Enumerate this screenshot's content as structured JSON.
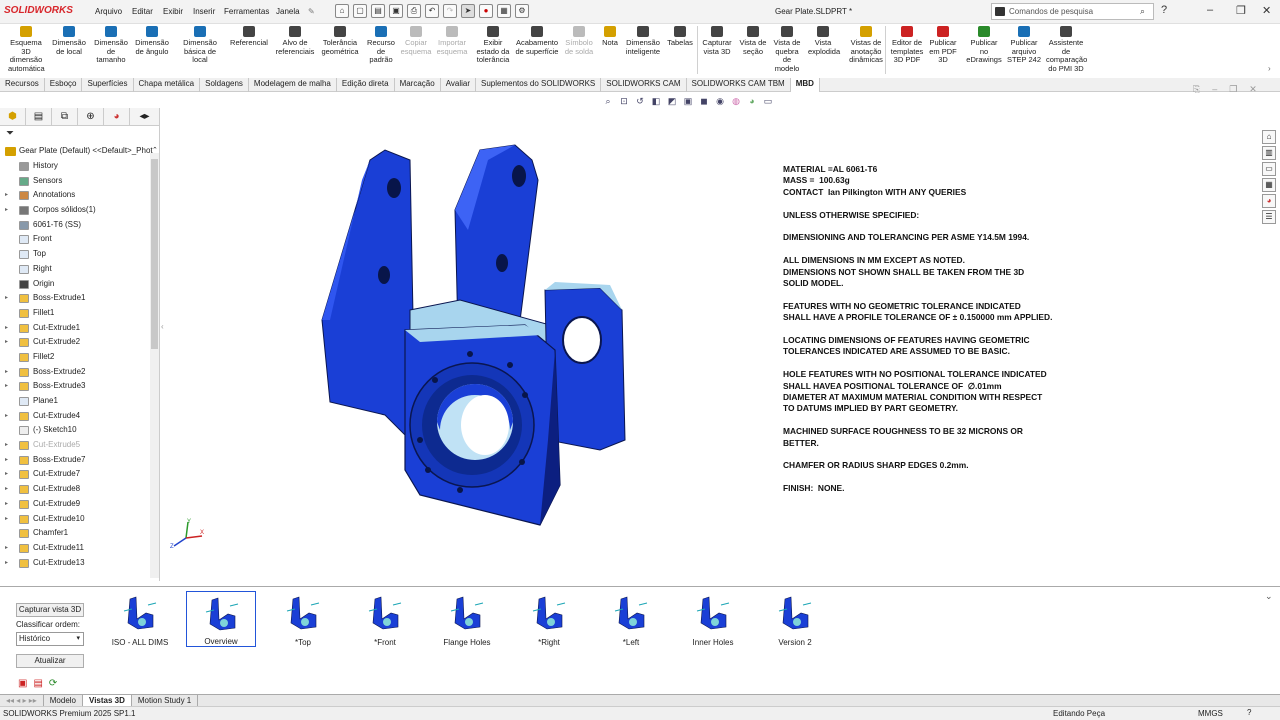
{
  "app": {
    "logo": "SOLIDWORKS",
    "menus": [
      "Arquivo",
      "Editar",
      "Exibir",
      "Inserir",
      "Ferramentas",
      "Janela"
    ],
    "doc_title": "Gear Plate.SLDPRT *",
    "search_placeholder": "Comandos de pesquisa"
  },
  "ribbon": [
    "Esquema 3D dimensão automática",
    "Dimensão de local",
    "Dimensão de tamanho",
    "Dimensão de ângulo",
    "Dimensão básica de local",
    "Referencial",
    "Alvo de referenciais",
    "Tolerância geométrica",
    "Recurso de padrão",
    "Copiar esquema",
    "Importar esquema",
    "Exibir estado da tolerância",
    "Acabamento de superfície",
    "Símbolo de solda",
    "Nota",
    "Dimensão inteligente",
    "Tabelas",
    "Capturar vista 3D",
    "Vista de seção",
    "Vista de quebra de modelo",
    "Vista explodida",
    "Vistas de anotação dinâmicas",
    "Editor de templates 3D PDF",
    "Publicar em PDF 3D",
    "Publicar no eDrawings",
    "Publicar arquivo STEP 242",
    "Assistente de comparação do PMI 3D"
  ],
  "tabs": [
    "Recursos",
    "Esboço",
    "Superfícies",
    "Chapa metálica",
    "Soldagens",
    "Modelagem de malha",
    "Edição direta",
    "Marcação",
    "Avaliar",
    "Suplementos do SOLIDWORKS",
    "SOLIDWORKS CAM",
    "SOLIDWORKS CAM TBM",
    "MBD"
  ],
  "active_tab": "MBD",
  "tree": {
    "root": "Gear Plate (Default) <<Default>_Phot",
    "items": [
      {
        "label": "History",
        "icon": "history-icon",
        "exp": false,
        "dim": false
      },
      {
        "label": "Sensors",
        "icon": "sensor-icon",
        "exp": false,
        "dim": false
      },
      {
        "label": "Annotations",
        "icon": "annotation-icon",
        "exp": true,
        "dim": false
      },
      {
        "label": "Corpos sólidos(1)",
        "icon": "solid-bodies-icon",
        "exp": true,
        "dim": false
      },
      {
        "label": "6061-T6 (SS)",
        "icon": "material-icon",
        "exp": false,
        "dim": false
      },
      {
        "label": "Front",
        "icon": "plane-icon",
        "exp": false,
        "dim": false
      },
      {
        "label": "Top",
        "icon": "plane-icon",
        "exp": false,
        "dim": false
      },
      {
        "label": "Right",
        "icon": "plane-icon",
        "exp": false,
        "dim": false
      },
      {
        "label": "Origin",
        "icon": "origin-icon",
        "exp": false,
        "dim": false
      },
      {
        "label": "Boss-Extrude1",
        "icon": "boss-extrude-icon",
        "exp": true,
        "dim": false
      },
      {
        "label": "Fillet1",
        "icon": "fillet-icon",
        "exp": false,
        "dim": false
      },
      {
        "label": "Cut-Extrude1",
        "icon": "cut-extrude-icon",
        "exp": true,
        "dim": false
      },
      {
        "label": "Cut-Extrude2",
        "icon": "cut-extrude-icon",
        "exp": true,
        "dim": false
      },
      {
        "label": "Fillet2",
        "icon": "fillet-icon",
        "exp": false,
        "dim": false
      },
      {
        "label": "Boss-Extrude2",
        "icon": "boss-extrude-icon",
        "exp": true,
        "dim": false
      },
      {
        "label": "Boss-Extrude3",
        "icon": "boss-extrude-icon",
        "exp": true,
        "dim": false
      },
      {
        "label": "Plane1",
        "icon": "plane-icon",
        "exp": false,
        "dim": false
      },
      {
        "label": "Cut-Extrude4",
        "icon": "cut-extrude-icon",
        "exp": true,
        "dim": false
      },
      {
        "label": "(-) Sketch10",
        "icon": "sketch-icon",
        "exp": false,
        "dim": false
      },
      {
        "label": "Cut-Extrude5",
        "icon": "cut-extrude-icon",
        "exp": true,
        "dim": true
      },
      {
        "label": "Boss-Extrude7",
        "icon": "boss-extrude-icon",
        "exp": true,
        "dim": false
      },
      {
        "label": "Cut-Extrude7",
        "icon": "cut-extrude-icon",
        "exp": true,
        "dim": false
      },
      {
        "label": "Cut-Extrude8",
        "icon": "cut-extrude-icon",
        "exp": true,
        "dim": false
      },
      {
        "label": "Cut-Extrude9",
        "icon": "cut-extrude-icon",
        "exp": true,
        "dim": false
      },
      {
        "label": "Cut-Extrude10",
        "icon": "cut-extrude-icon",
        "exp": true,
        "dim": false
      },
      {
        "label": "Chamfer1",
        "icon": "chamfer-icon",
        "exp": false,
        "dim": false
      },
      {
        "label": "Cut-Extrude11",
        "icon": "cut-extrude-icon",
        "exp": true,
        "dim": false
      },
      {
        "label": "Cut-Extrude13",
        "icon": "cut-extrude-icon",
        "exp": true,
        "dim": false
      }
    ]
  },
  "notes": [
    "MATERIAL =AL 6061-T6\nMASS =  100.63g\nCONTACT  Ian Pilkington WITH ANY QUERIES",
    "UNLESS OTHERWISE SPECIFIED:",
    "DIMENSIONING AND TOLERANCING PER ASME Y14.5M 1994.",
    "ALL DIMENSIONS IN MM EXCEPT AS NOTED.\nDIMENSIONS NOT SHOWN SHALL BE TAKEN FROM THE 3D\nSOLID MODEL.",
    "FEATURES WITH NO GEOMETRIC TOLERANCE INDICATED\nSHALL HAVE A PROFILE TOLERANCE OF ± 0.150000 mm APPLIED.",
    "LOCATING DIMENSIONS OF FEATURES HAVING GEOMETRIC\nTOLERANCES INDICATED ARE ASSUMED TO BE BASIC.",
    "HOLE FEATURES WITH NO POSITIONAL TOLERANCE INDICATED\nSHALL HAVEA POSITIONAL TOLERANCE OF  ∅.01mm\nDIAMETER AT MAXIMUM MATERIAL CONDITION WITH RESPECT\nTO DATUMS IMPLIED BY PART GEOMETRY.",
    "MACHINED SURFACE ROUGHNESS TO BE 32 MICRONS OR\nBETTER.",
    "CHAMFER OR RADIUS SHARP EDGES 0.2mm.",
    "FINISH:  NONE."
  ],
  "views3d": {
    "capture_button": "Capturar vista 3D",
    "sort_label": "Classificar ordem:",
    "sort_value": "Histórico",
    "update_button": "Atualizar",
    "views": [
      "ISO - ALL DIMS",
      "Overview",
      "*Top",
      "*Front",
      "Flange Holes",
      "*Right",
      "*Left",
      "Inner Holes",
      "Version 2"
    ],
    "selected": "Overview"
  },
  "bottom_tabs": [
    "Modelo",
    "Vistas 3D",
    "Motion Study 1"
  ],
  "active_bottom_tab": "Vistas 3D",
  "status": {
    "left": "SOLIDWORKS Premium 2025 SP1.1",
    "mode": "Editando Peça",
    "units": "MMGS"
  },
  "colors": {
    "part_blue": "#1a3fd6",
    "part_dark": "#0c1f80",
    "accent": "#2255d9",
    "logo_red": "#d8262b"
  }
}
